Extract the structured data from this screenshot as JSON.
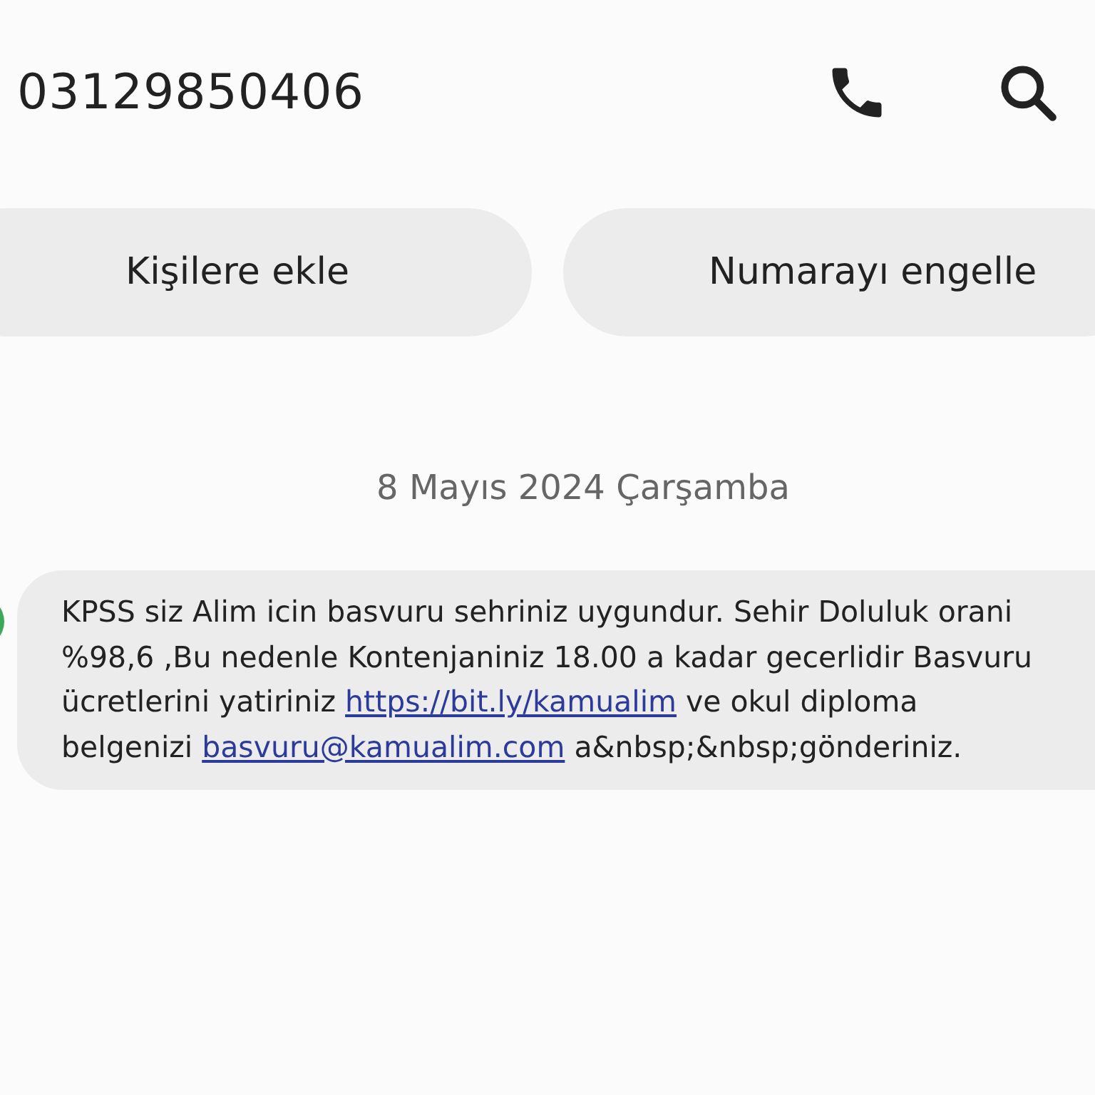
{
  "header": {
    "title": "03129850406"
  },
  "actions": [
    {
      "label": "Kişilere ekle"
    },
    {
      "label": "Numarayı engelle"
    }
  ],
  "date": "8 Mayıs 2024 Çarşamba",
  "message": {
    "segments": [
      {
        "kind": "text",
        "text": "KPSS siz Alim icin basvuru sehriniz uygundur. Sehir Doluluk orani %98,6 ,Bu nedenle Kontenjaniniz 18.00 a kadar gecerlidir Basvuru ücretlerini yatiriniz "
      },
      {
        "kind": "link",
        "text": "https://bit.ly/kamualim"
      },
      {
        "kind": "text",
        "text": " ve okul diploma belgenizi "
      },
      {
        "kind": "link",
        "text": "basvuru@kamualim.com"
      },
      {
        "kind": "text",
        "text": " a&nbsp;&nbsp;gönderiniz."
      }
    ]
  }
}
